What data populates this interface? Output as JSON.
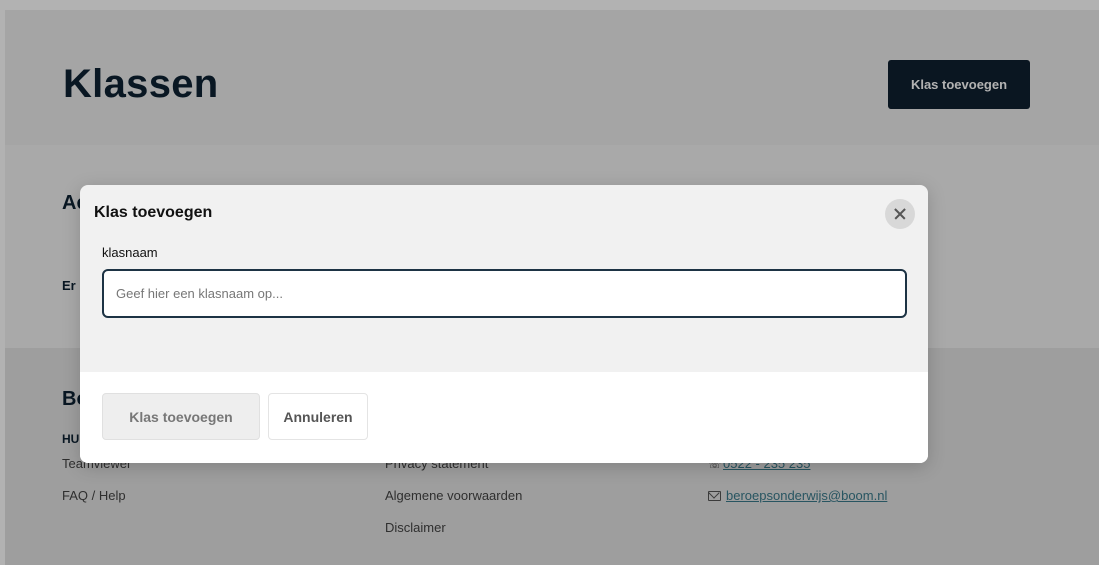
{
  "header": {
    "title": "Klassen",
    "add_button_label": "Klas toevoegen"
  },
  "main": {
    "section_heading": "Ac",
    "empty_text": "Er"
  },
  "footer": {
    "heading": "Bo",
    "subheading": "HU",
    "col1": [
      "Teamviewer",
      "FAQ / Help"
    ],
    "col2": [
      "Privacy statement",
      "Algemene voorwaarden",
      "Disclaimer"
    ],
    "phone": "0522 - 235 235",
    "email": "beroepsonderwijs@boom.nl"
  },
  "modal": {
    "title": "Klas toevoegen",
    "field_label": "klasnaam",
    "input_value": "",
    "input_placeholder": "Geef hier een klasnaam op...",
    "submit_label": "Klas toevoegen",
    "cancel_label": "Annuleren"
  }
}
